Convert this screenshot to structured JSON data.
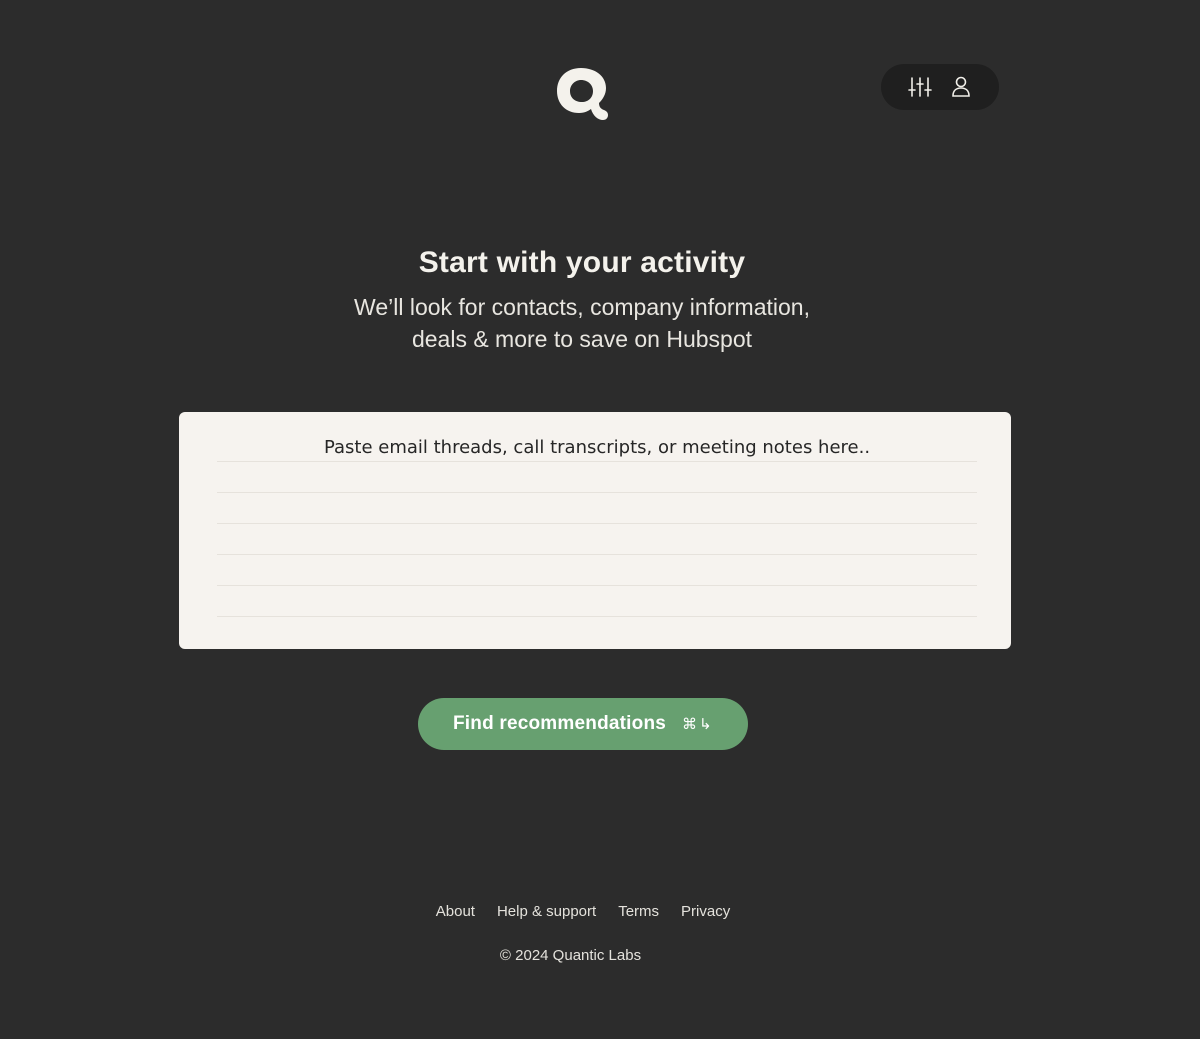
{
  "brand": {
    "logo_icon": "q-logo-icon"
  },
  "toolbar": {
    "settings_icon": "sliders-icon",
    "account_icon": "user-icon"
  },
  "hero": {
    "title": "Start with your activity",
    "subtitle_line1": "We’ll look for contacts, company information,",
    "subtitle_line2": "deals & more to save on Hubspot"
  },
  "paste": {
    "placeholder": "Paste email threads, call transcripts, or meeting notes here.."
  },
  "cta": {
    "label": "Find recommendations",
    "shortcut_cmd": "⌘",
    "shortcut_enter": "↳",
    "color": "#67a070"
  },
  "footer": {
    "links": [
      "About",
      "Help & support",
      "Terms",
      "Privacy"
    ],
    "copyright": "© 2024 Quantic Labs"
  },
  "colors": {
    "background": "#2c2c2c",
    "card": "#f6f3ef",
    "pill": "#1f1f1f"
  }
}
